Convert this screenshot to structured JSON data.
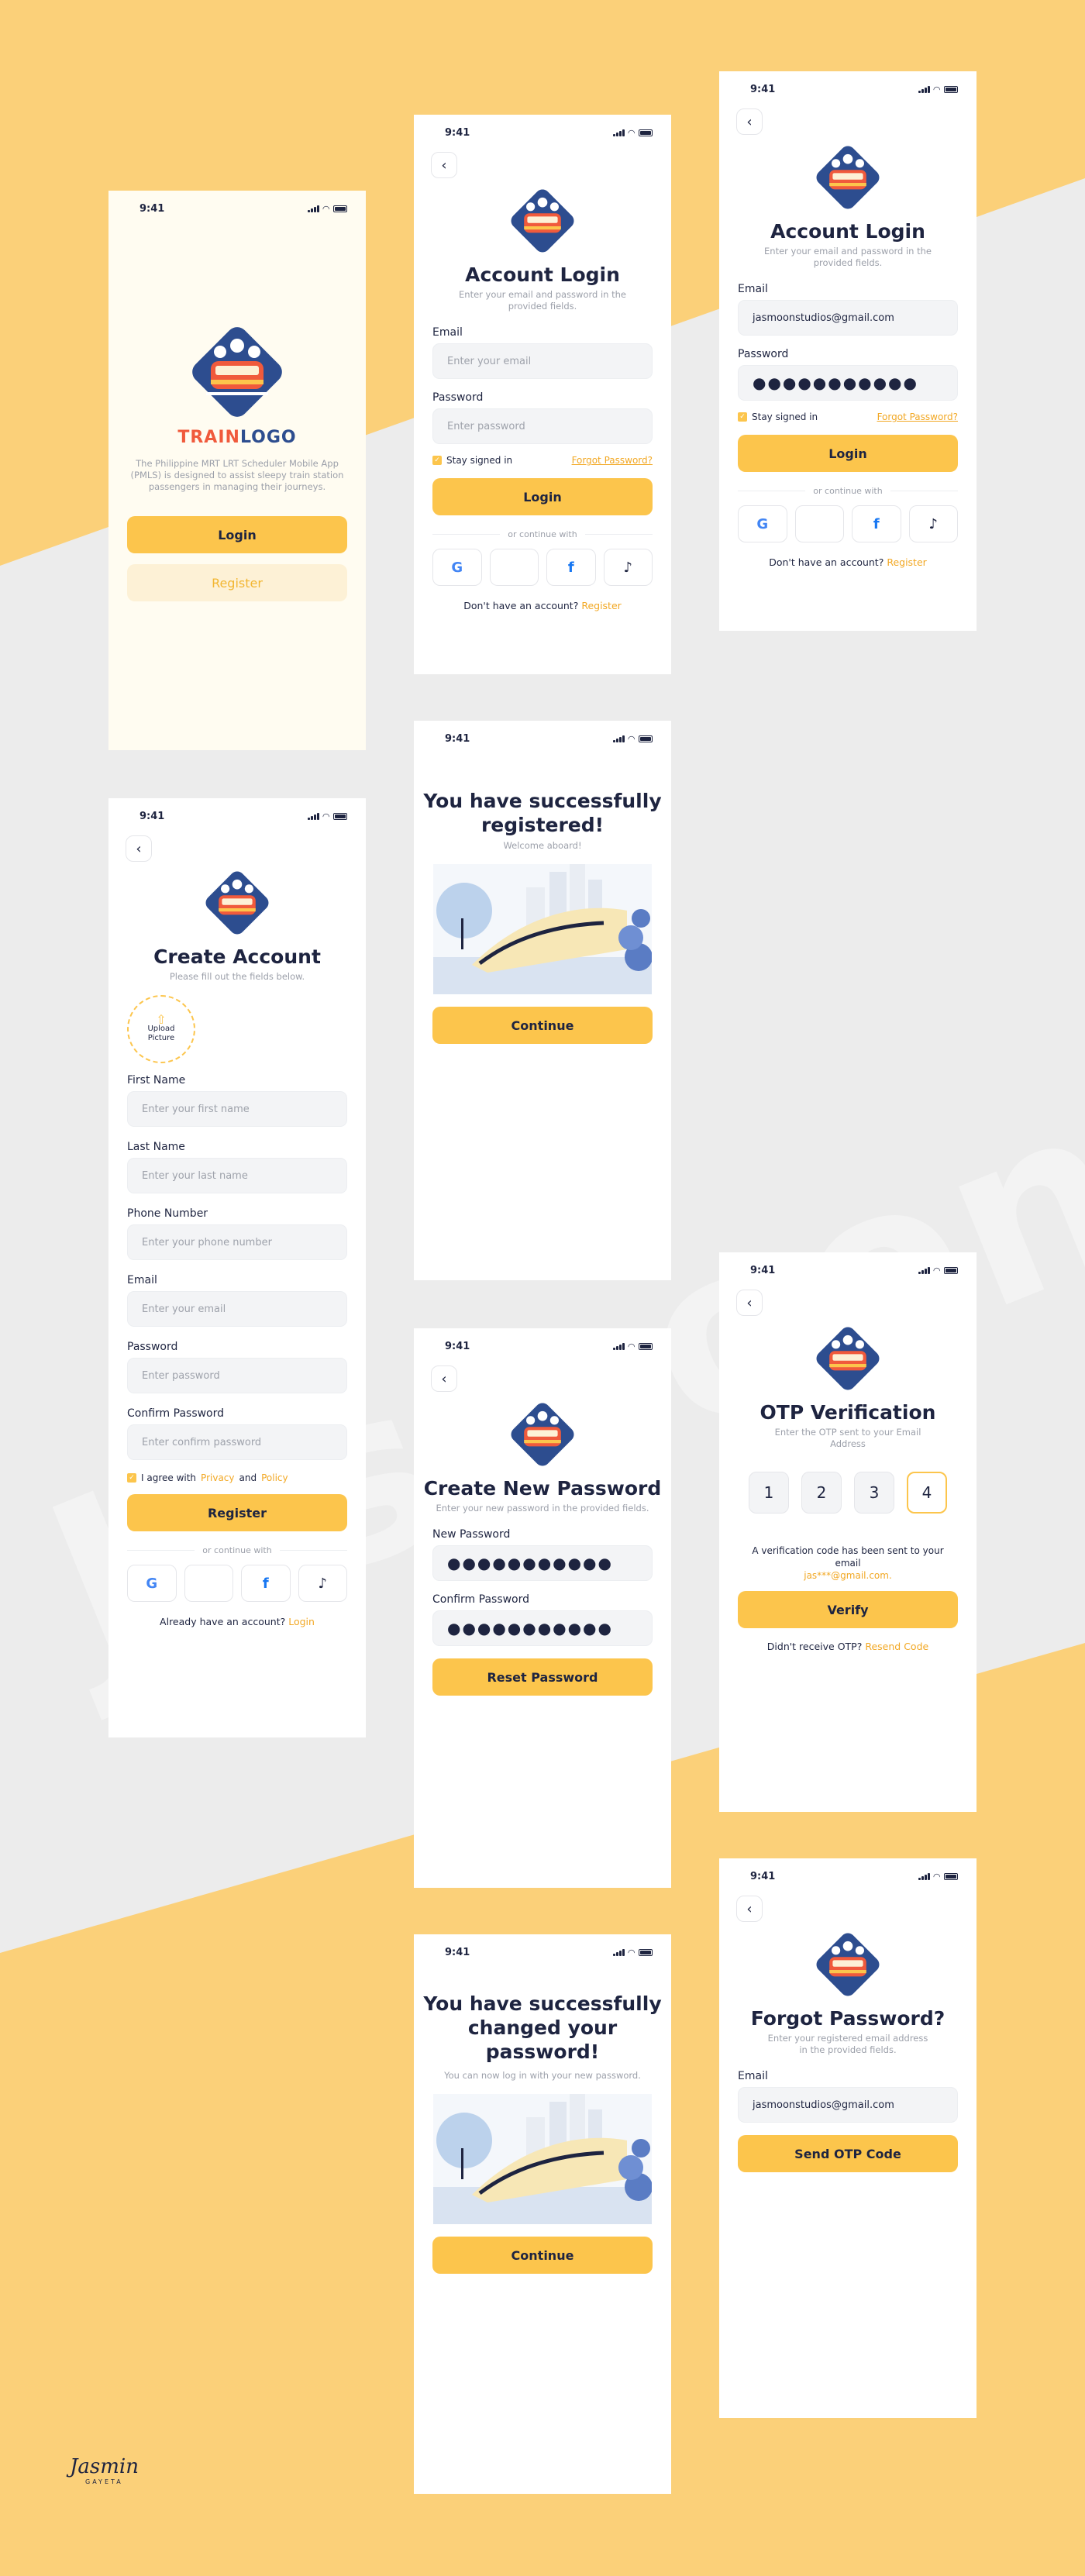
{
  "status_time": "9:41",
  "brand": {
    "logo_train": "TRAIN",
    "logo_word": "LOGO",
    "description": "The Philippine MRT LRT Scheduler Mobile App (PMLS) is designed to assist sleepy train station passengers in managing their journeys."
  },
  "welcome": {
    "login": "Login",
    "register": "Register"
  },
  "login": {
    "title": "Account Login",
    "subtitle": "Enter your email and password in the provided fields.",
    "email_label": "Email",
    "email_placeholder": "Enter your email",
    "password_label": "Password",
    "password_placeholder": "Enter password",
    "stay": "Stay signed in",
    "forgot": "Forgot Password?",
    "button": "Login",
    "or": "or continue with",
    "no_account": "Don't have an account?",
    "register_link": "Register"
  },
  "login_filled": {
    "email": "jasmoonstudios@gmail.com",
    "password": "●●●●●●●●●●●"
  },
  "register_success": {
    "title_line1": "You have successfully",
    "title_line2": "registered!",
    "subtitle": "Welcome aboard!",
    "button": "Continue"
  },
  "create": {
    "title": "Create Account",
    "subtitle": "Please fill out the fields below.",
    "upload_line1": "Upload",
    "upload_line2": "Picture",
    "first_label": "First Name",
    "first_ph": "Enter your first name",
    "last_label": "Last Name",
    "last_ph": "Enter your last name",
    "phone_label": "Phone Number",
    "phone_ph": "Enter your phone number",
    "email_label": "Email",
    "email_ph": "Enter your email",
    "password_label": "Password",
    "password_ph": "Enter password",
    "confirm_label": "Confirm Password",
    "confirm_ph": "Enter confirm password",
    "agree": "I agree with",
    "privacy": "Privacy",
    "and": "and",
    "policy": "Policy",
    "button": "Register",
    "or": "or continue with",
    "have_account": "Already have an account?",
    "login_link": "Login"
  },
  "new_password": {
    "title": "Create New Password",
    "subtitle": "Enter your new password in the provided fields.",
    "new_label": "New Password",
    "confirm_label": "Confirm Password",
    "value": "●●●●●●●●●●●",
    "button": "Reset Password"
  },
  "otp": {
    "title": "OTP Verification",
    "subtitle": "Enter the OTP sent to your Email Address",
    "digits": [
      "1",
      "2",
      "3",
      "4"
    ],
    "sent_text": "A verification code has been sent to your email",
    "sent_email": "jas***@gmail.com.",
    "button": "Verify",
    "didnt": "Didn't receive OTP?",
    "resend": "Resend Code"
  },
  "changed": {
    "title_line1": "You have successfully",
    "title_line2": "changed your",
    "title_line3": "password!",
    "subtitle": "You can now log in with your new password.",
    "button": "Continue"
  },
  "forgot": {
    "title": "Forgot Password?",
    "subtitle": "Enter your registered email address in the provided fields.",
    "email_label": "Email",
    "email_value": "jasmoonstudios@gmail.com",
    "button": "Send OTP Code"
  },
  "watermark": "Jasmoon",
  "signature": {
    "name": "Jasmin",
    "surname": "GAYETA"
  },
  "colors": {
    "accent": "#fcc54c",
    "background": "#fbd079",
    "gray_band": "#ececec",
    "navy": "#1e2440"
  },
  "icons": [
    "google-icon",
    "apple-icon",
    "facebook-icon",
    "tiktok-icon",
    "back-chevron-icon",
    "upload-icon",
    "signal-icon",
    "wifi-icon",
    "battery-icon"
  ]
}
